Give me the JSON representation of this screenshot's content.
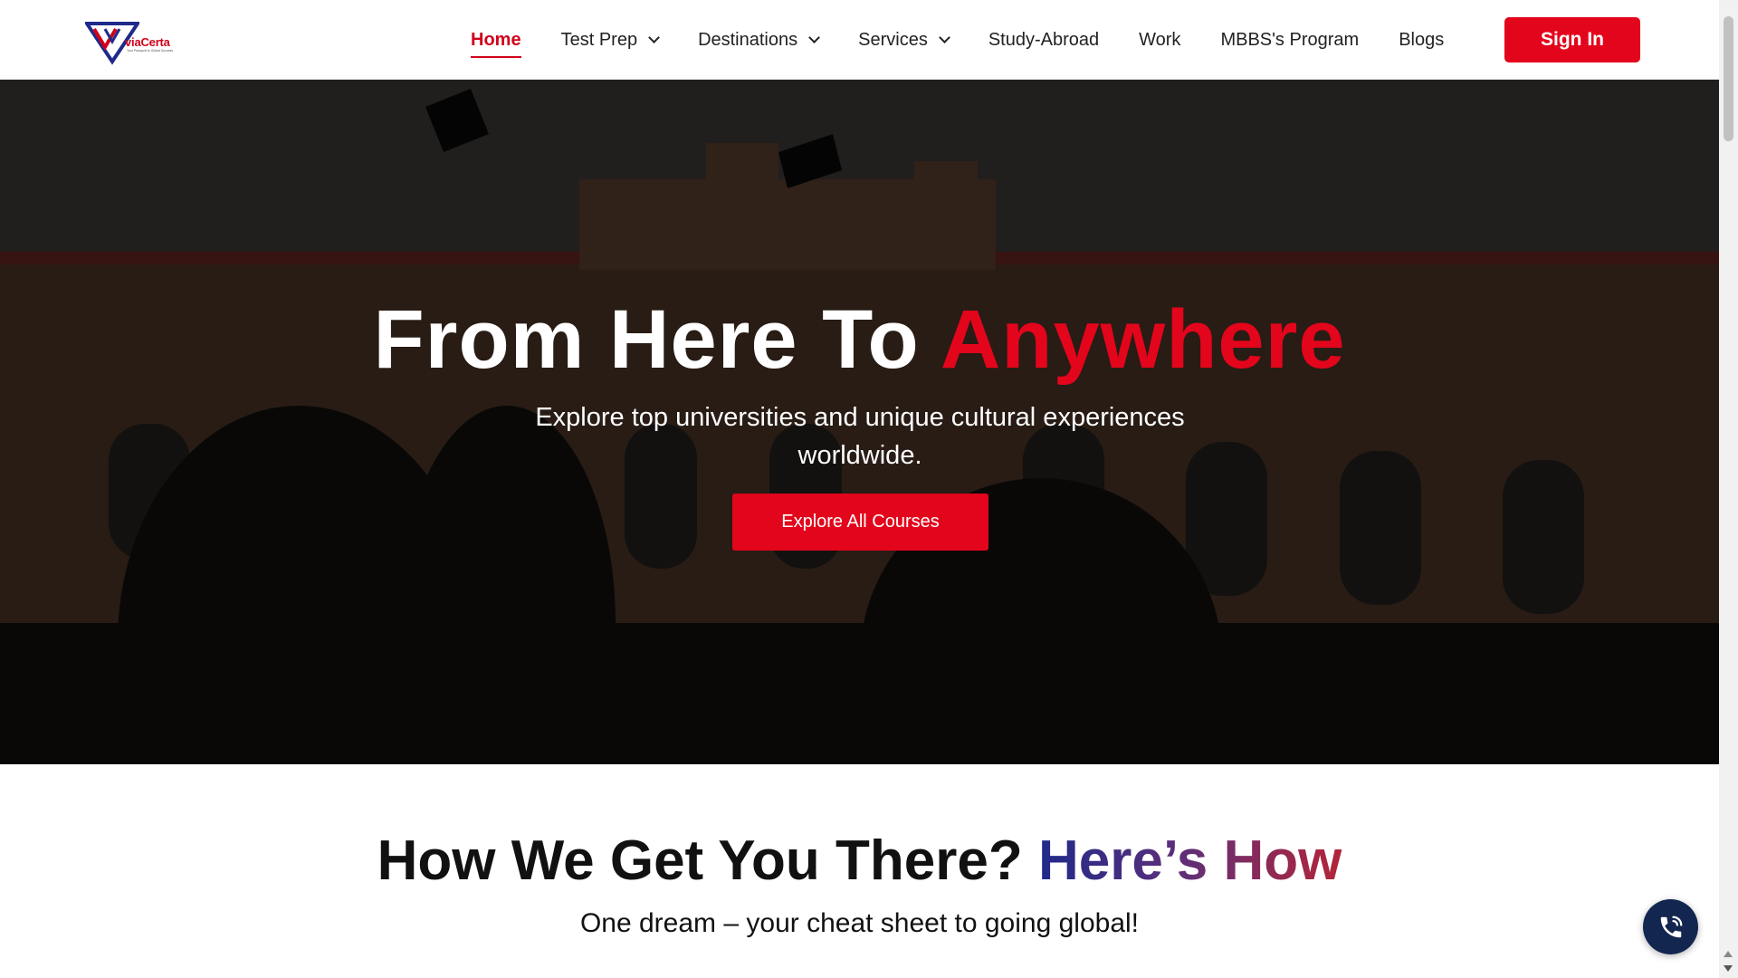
{
  "brand": {
    "name": "viaCerta",
    "tagline": "Your Passport to Global Success",
    "colors": {
      "primary": "#e3051b",
      "navy": "#12264f",
      "logo_blue": "#1f2a8a"
    }
  },
  "nav": {
    "items": [
      {
        "label": "Home",
        "active": true,
        "dropdown": false
      },
      {
        "label": "Test Prep",
        "active": false,
        "dropdown": true
      },
      {
        "label": "Destinations",
        "active": false,
        "dropdown": true
      },
      {
        "label": "Services",
        "active": false,
        "dropdown": true
      },
      {
        "label": "Study-Abroad",
        "active": false,
        "dropdown": false
      },
      {
        "label": "Work",
        "active": false,
        "dropdown": false
      },
      {
        "label": "MBBS's Program",
        "active": false,
        "dropdown": false
      },
      {
        "label": "Blogs",
        "active": false,
        "dropdown": false
      }
    ],
    "signin_label": "Sign In"
  },
  "hero": {
    "title_main": "From Here To ",
    "title_accent": "Anywhere",
    "subtitle": "Explore top universities and unique cultural experiences worldwide.",
    "cta_label": "Explore All Courses"
  },
  "how": {
    "title_main": "How We Get You There? ",
    "title_accent": "Here’s How",
    "subtitle": "One dream – your cheat sheet to going global!"
  },
  "icons": {
    "call": "phone-call-icon",
    "dropdown": "chevron-down-icon"
  }
}
